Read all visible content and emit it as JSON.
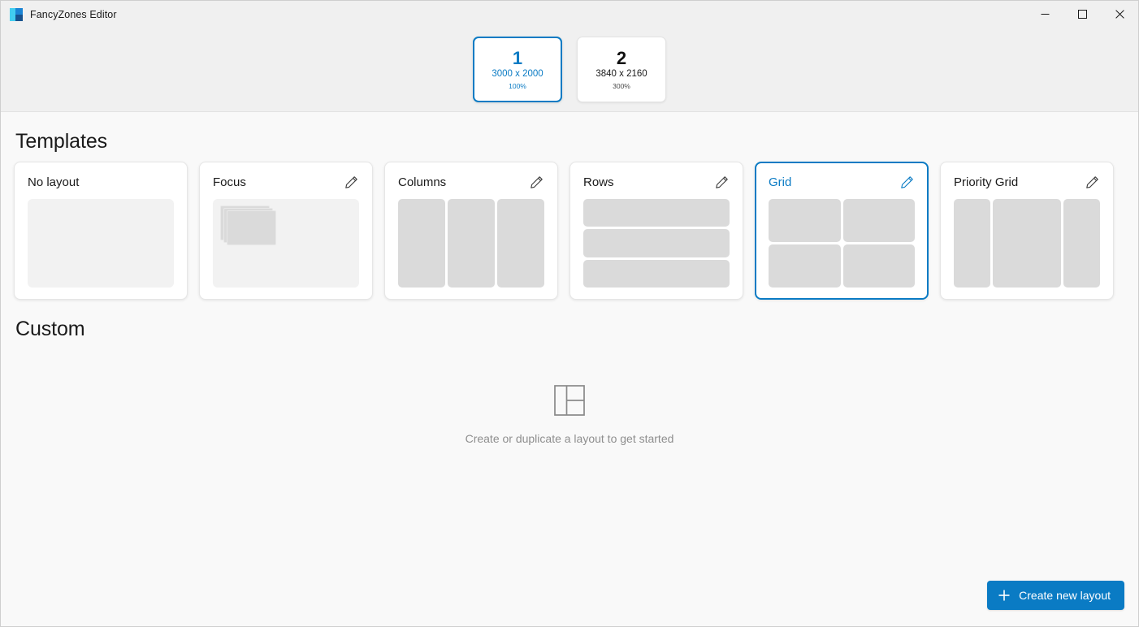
{
  "window": {
    "title": "FancyZones Editor",
    "app_icon": "fancyzones-icon",
    "controls": {
      "minimize": "minimize-icon",
      "maximize": "maximize-icon",
      "close": "close-icon"
    }
  },
  "accent_color": "#0a7bc4",
  "monitors": [
    {
      "number": "1",
      "resolution": "3000 x 2000",
      "scale": "100%",
      "selected": true
    },
    {
      "number": "2",
      "resolution": "3840 x 2160",
      "scale": "300%",
      "selected": false
    }
  ],
  "templates": {
    "heading": "Templates",
    "edit_icon": "pencil-icon",
    "items": [
      {
        "name": "No layout",
        "preview": "empty",
        "editable": false,
        "selected": false
      },
      {
        "name": "Focus",
        "preview": "focus",
        "editable": true,
        "selected": false
      },
      {
        "name": "Columns",
        "preview": "columns",
        "editable": true,
        "selected": false
      },
      {
        "name": "Rows",
        "preview": "rows",
        "editable": true,
        "selected": false
      },
      {
        "name": "Grid",
        "preview": "grid",
        "editable": true,
        "selected": true
      },
      {
        "name": "Priority Grid",
        "preview": "priority",
        "editable": true,
        "selected": false
      }
    ]
  },
  "custom": {
    "heading": "Custom",
    "empty_icon": "layout-placeholder-icon",
    "empty_text": "Create or duplicate a layout to get started"
  },
  "create_button": {
    "label": "Create new layout",
    "icon": "plus-icon"
  }
}
